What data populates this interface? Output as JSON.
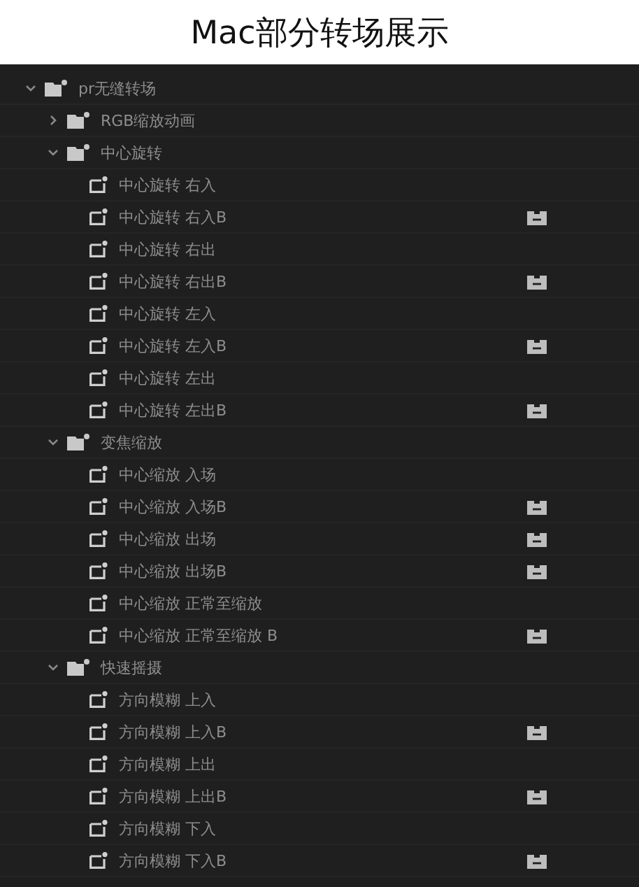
{
  "title": "Mac部分转场展示",
  "tree": [
    {
      "label": "pr无缝转场",
      "kind": "folder",
      "expanded": true,
      "children": [
        {
          "label": "RGB缩放动画",
          "kind": "folder",
          "expanded": false
        },
        {
          "label": "中心旋转",
          "kind": "folder",
          "expanded": true,
          "children": [
            {
              "label": "中心旋转 右入",
              "kind": "effect",
              "accelerated": false
            },
            {
              "label": "中心旋转 右入B",
              "kind": "effect",
              "accelerated": true
            },
            {
              "label": "中心旋转 右出",
              "kind": "effect",
              "accelerated": false
            },
            {
              "label": "中心旋转 右出B",
              "kind": "effect",
              "accelerated": true
            },
            {
              "label": "中心旋转 左入",
              "kind": "effect",
              "accelerated": false
            },
            {
              "label": "中心旋转 左入B",
              "kind": "effect",
              "accelerated": true
            },
            {
              "label": "中心旋转 左出",
              "kind": "effect",
              "accelerated": false
            },
            {
              "label": "中心旋转 左出B",
              "kind": "effect",
              "accelerated": true
            }
          ]
        },
        {
          "label": "变焦缩放",
          "kind": "folder",
          "expanded": true,
          "children": [
            {
              "label": "中心缩放 入场",
              "kind": "effect",
              "accelerated": false
            },
            {
              "label": "中心缩放 入场B",
              "kind": "effect",
              "accelerated": true
            },
            {
              "label": "中心缩放 出场",
              "kind": "effect",
              "accelerated": true
            },
            {
              "label": "中心缩放 出场B",
              "kind": "effect",
              "accelerated": true
            },
            {
              "label": "中心缩放 正常至缩放",
              "kind": "effect",
              "accelerated": false
            },
            {
              "label": "中心缩放 正常至缩放 B",
              "kind": "effect",
              "accelerated": true
            }
          ]
        },
        {
          "label": "快速摇摄",
          "kind": "folder",
          "expanded": true,
          "children": [
            {
              "label": "方向模糊 上入",
              "kind": "effect",
              "accelerated": false
            },
            {
              "label": "方向模糊 上入B",
              "kind": "effect",
              "accelerated": true
            },
            {
              "label": "方向模糊 上出",
              "kind": "effect",
              "accelerated": false
            },
            {
              "label": "方向模糊 上出B",
              "kind": "effect",
              "accelerated": true
            },
            {
              "label": "方向模糊 下入",
              "kind": "effect",
              "accelerated": false
            },
            {
              "label": "方向模糊 下入B",
              "kind": "effect",
              "accelerated": true
            }
          ]
        }
      ]
    }
  ]
}
